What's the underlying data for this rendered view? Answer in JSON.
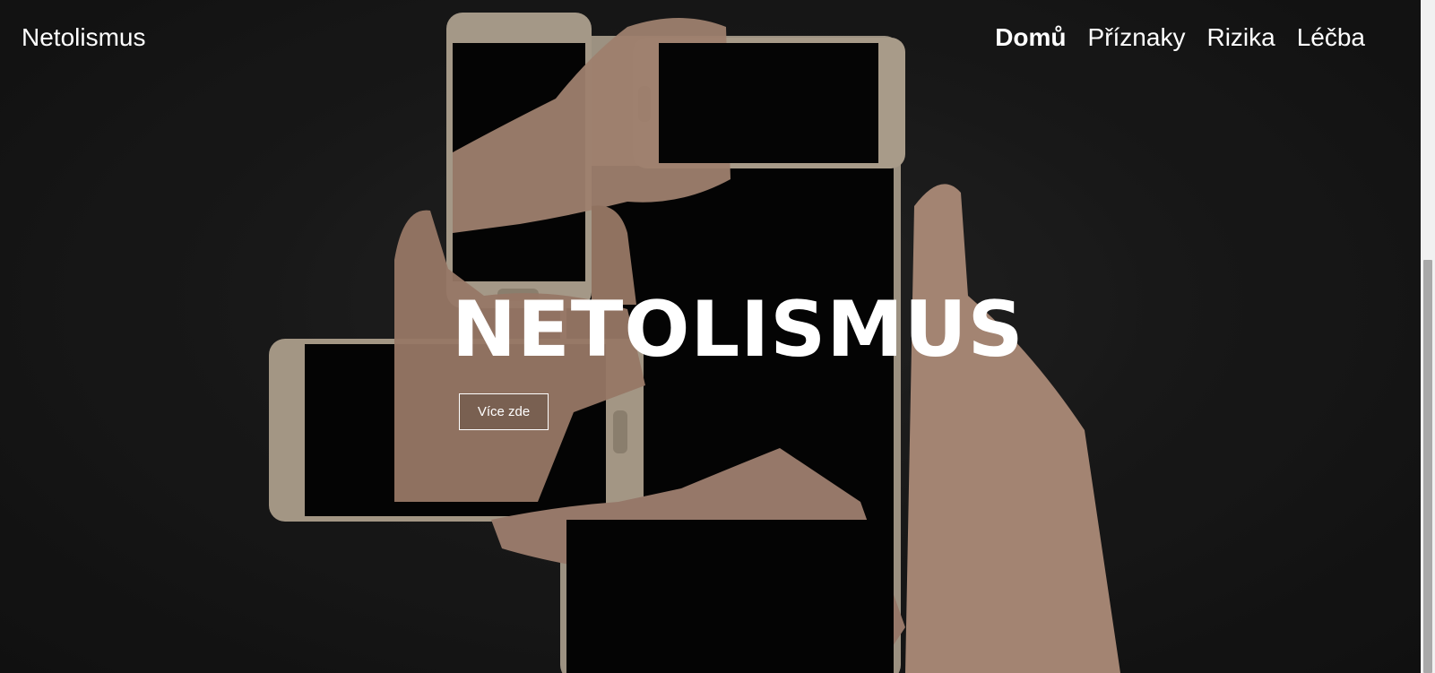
{
  "brand": "Netolismus",
  "nav": {
    "items": [
      "Domů",
      "Příznaky",
      "Rizika",
      "Léčba"
    ],
    "active": "Domů"
  },
  "hero": {
    "title": "NETOLISMUS",
    "button_label": "Více zde"
  },
  "colors": {
    "background": "#1c1c1c",
    "text": "#ffffff",
    "phone_body": "#c8b8a2",
    "skin": "#c79f8a"
  },
  "icons": [
    "phone-hands-image"
  ]
}
